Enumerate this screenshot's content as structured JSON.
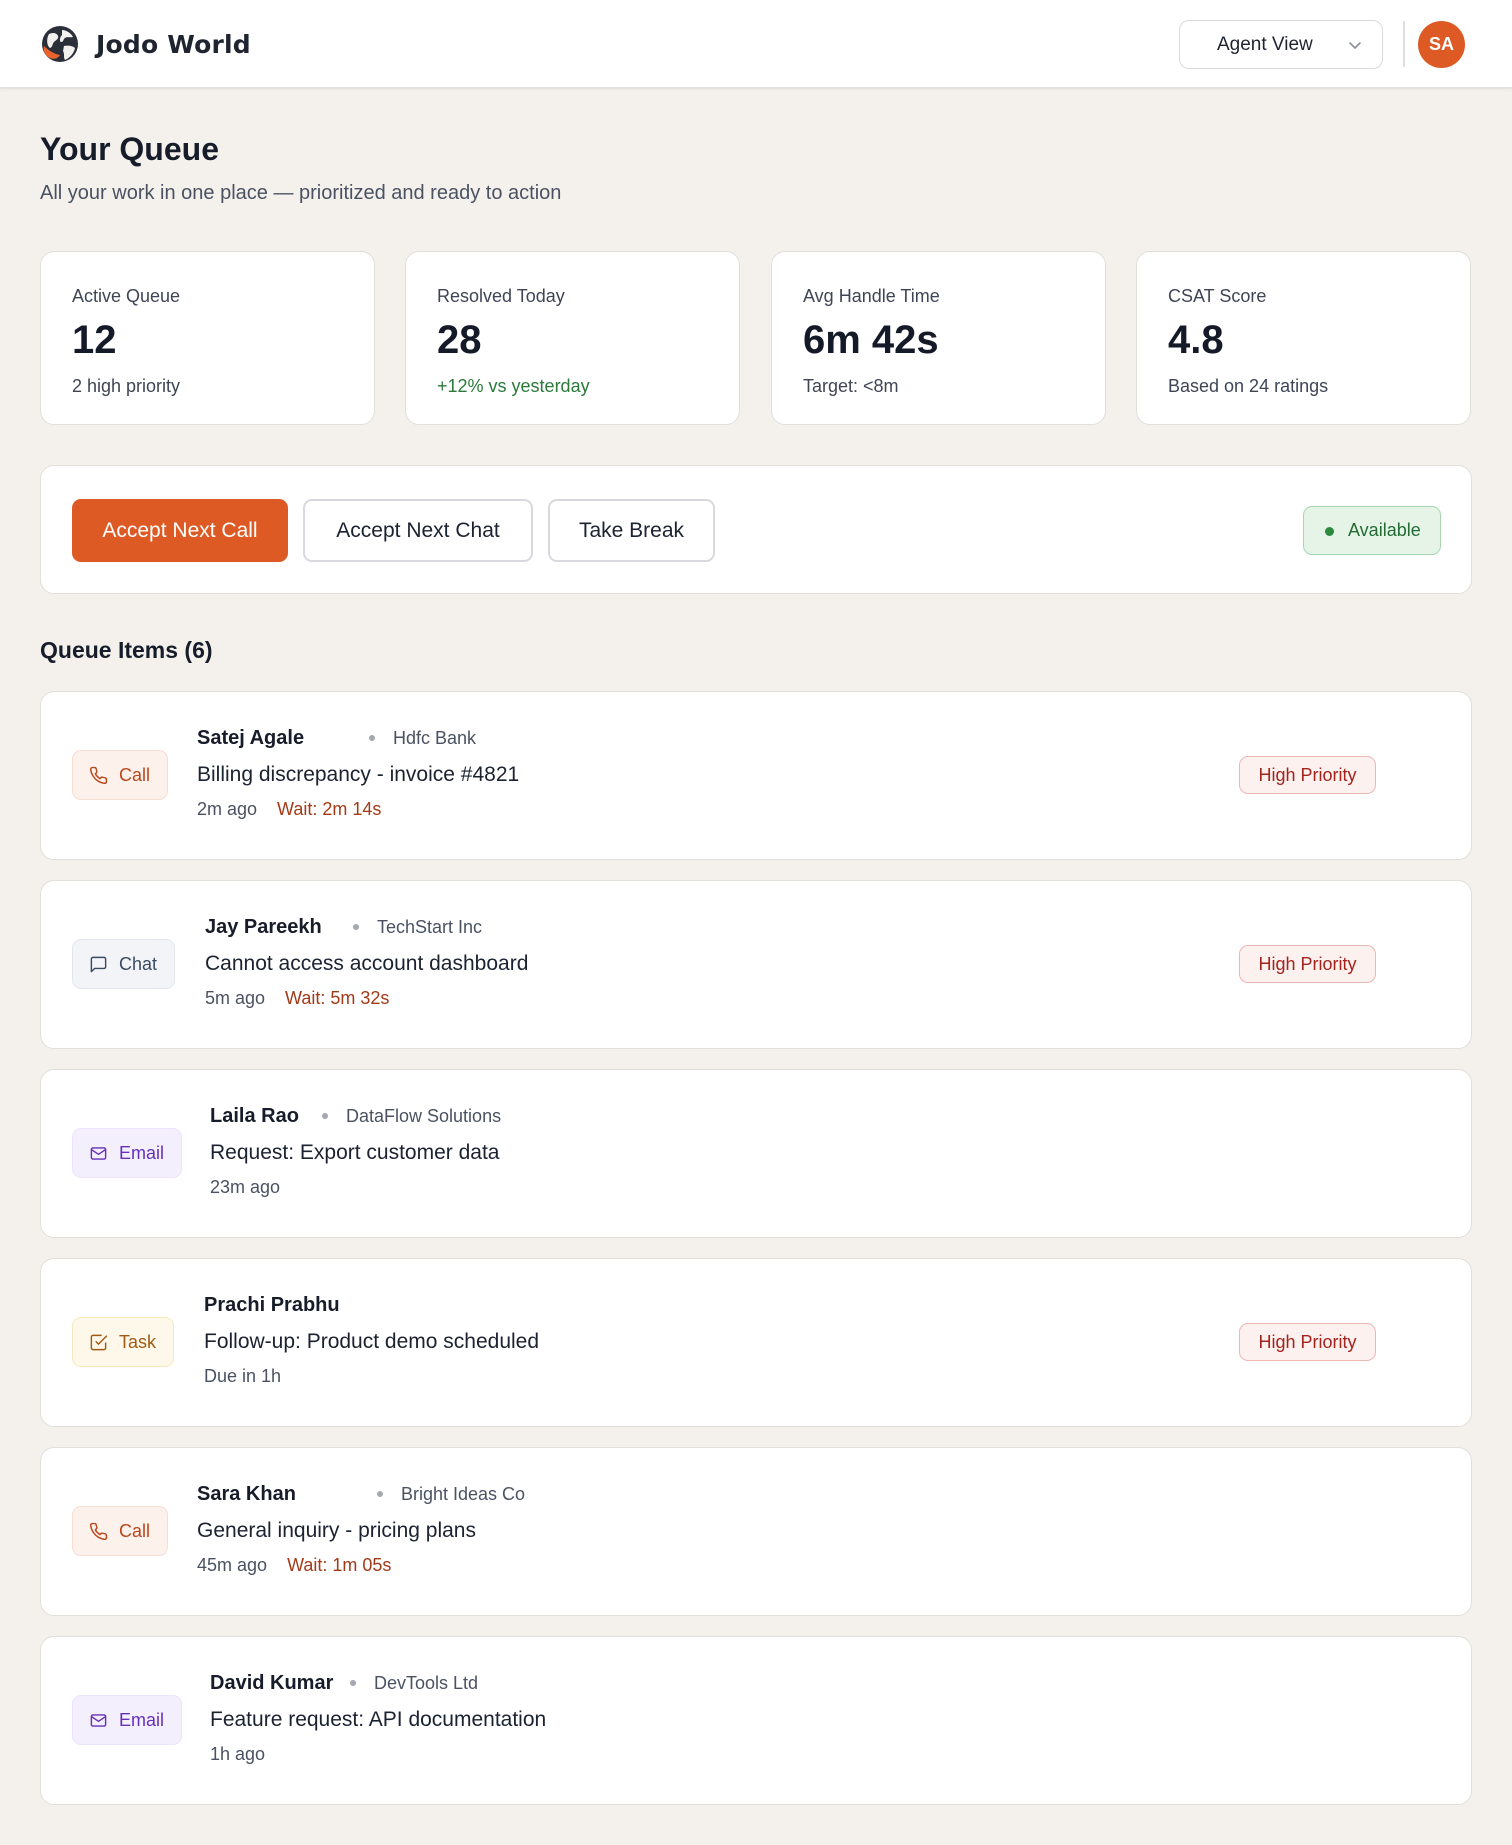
{
  "header": {
    "brand_name": "Jodo World",
    "view_select_value": "Agent View",
    "avatar_initials": "SA"
  },
  "page": {
    "title": "Your Queue",
    "subtitle": "All your work in one place — prioritized and ready to action"
  },
  "stats": [
    {
      "label": "Active Queue",
      "value": "12",
      "note": "2 high priority"
    },
    {
      "label": "Resolved Today",
      "value": "28",
      "note": "+12% vs yesterday"
    },
    {
      "label": "Avg Handle Time",
      "value": "6m 42s",
      "note": "Target: <8m"
    },
    {
      "label": "CSAT Score",
      "value": "4.8",
      "note": "Based on 24 ratings"
    }
  ],
  "actions": {
    "accept_call": "Accept Next Call",
    "accept_chat": "Accept Next Chat",
    "take_break": "Take Break",
    "status": "Available"
  },
  "queue": {
    "title": "Queue Items (6)",
    "items": [
      {
        "type": "Call",
        "name": "Satej Agale",
        "company": "Hdfc Bank",
        "subject": "Billing discrepancy - invoice #4821",
        "time": "2m ago",
        "wait": "Wait: 2m 14s",
        "priority": "High Priority"
      },
      {
        "type": "Chat",
        "name": "Jay Pareekh",
        "company": "TechStart Inc",
        "subject": "Cannot access account dashboard",
        "time": "5m ago",
        "wait": "Wait: 5m 32s",
        "priority": "High Priority"
      },
      {
        "type": "Email",
        "name": "Laila Rao",
        "company": "DataFlow Solutions",
        "subject": "Request: Export customer data",
        "time": "23m ago",
        "wait": "",
        "priority": ""
      },
      {
        "type": "Task",
        "name": "Prachi Prabhu",
        "company": "",
        "subject": "Follow-up: Product demo scheduled",
        "time": "Due in 1h",
        "wait": "",
        "priority": "High Priority"
      },
      {
        "type": "Call",
        "name": "Sara Khan",
        "company": "Bright Ideas Co",
        "subject": "General inquiry - pricing plans",
        "time": "45m ago",
        "wait": "Wait: 1m 05s",
        "priority": ""
      },
      {
        "type": "Email",
        "name": "David Kumar",
        "company": "DevTools Ltd",
        "subject": "Feature request: API documentation",
        "time": "1h ago",
        "wait": "",
        "priority": ""
      }
    ]
  },
  "colors": {
    "accent": "#dd5a25",
    "page_bg": "#f4f1ed",
    "status_available": "#2b8a3e",
    "priority_high": "#a3241c"
  },
  "icons": {
    "logo": "globe-logo-icon",
    "view_chevron": "chevron-down-icon",
    "call": "phone-icon",
    "chat": "message-square-icon",
    "email": "mail-icon",
    "task": "check-square-icon"
  }
}
